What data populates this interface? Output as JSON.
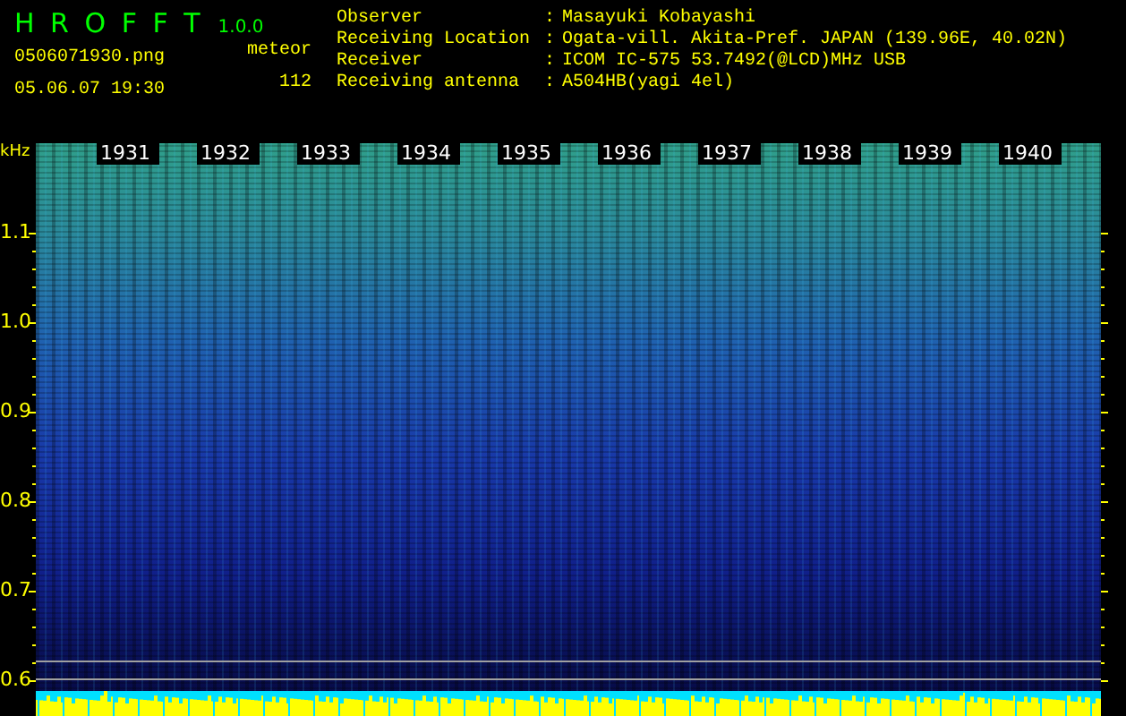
{
  "app": {
    "title": "H R O F F T",
    "version": "1.0.0",
    "filename": "0506071930.png",
    "datetime": "05.06.07 19:30"
  },
  "counter": {
    "label": "meteor",
    "value": "112"
  },
  "info": [
    {
      "label": "Observer",
      "separator": ":",
      "value": "Masayuki Kobayashi"
    },
    {
      "label": "Receiving Location",
      "separator": ":",
      "value": "Ogata-vill. Akita-Pref. JAPAN (139.96E, 40.02N)"
    },
    {
      "label": "Receiver",
      "separator": ":",
      "value": "ICOM IC-575 53.7492(@LCD)MHz USB"
    },
    {
      "label": "Receiving antenna",
      "separator": ":",
      "value": "A504HB(yagi 4el)"
    }
  ],
  "spectrogram": {
    "unit": "kHz",
    "y_labels": [
      "1.1",
      "1.0",
      "0.9",
      "0.8",
      "0.7",
      "0.6"
    ],
    "time_labels": [
      "1931",
      "1932",
      "1933",
      "1934",
      "1935",
      "1936",
      "1937",
      "1938",
      "1939",
      "1940"
    ]
  }
}
